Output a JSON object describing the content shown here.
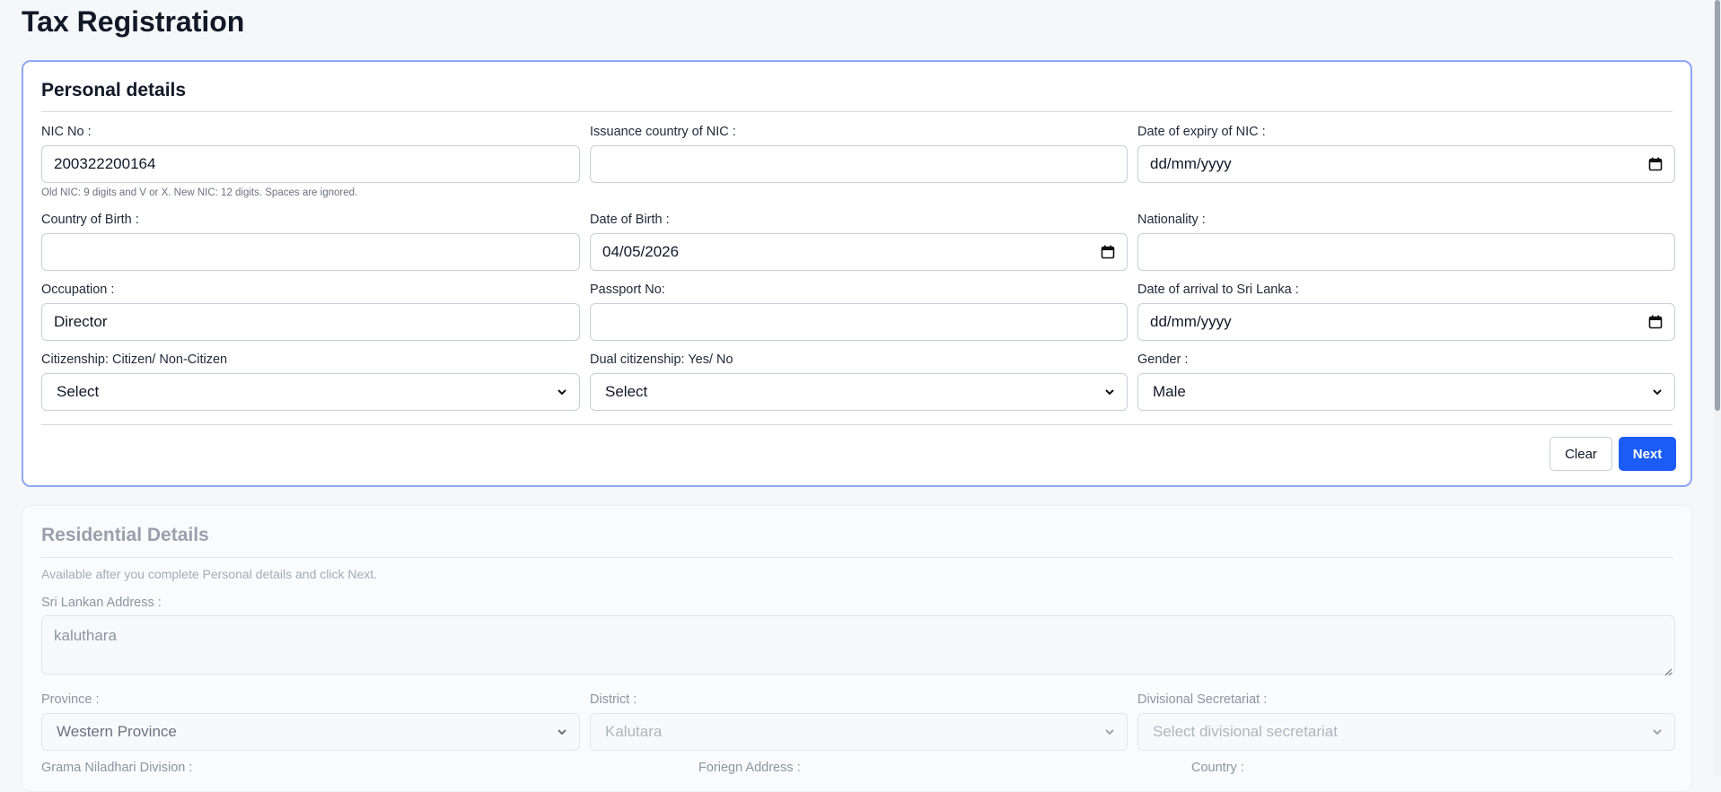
{
  "page": {
    "title": "Tax Registration"
  },
  "personal": {
    "title": "Personal details",
    "nic_label": "NIC No :",
    "nic_value": "200322200164",
    "nic_hint": "Old NIC: 9 digits and V or X. New NIC: 12 digits. Spaces are ignored.",
    "issuance_label": "Issuance country of NIC :",
    "issuance_value": "",
    "expiry_label": "Date of expiry of NIC :",
    "expiry_value": "dd/mm/yyyy",
    "birth_country_label": "Country of Birth :",
    "birth_country_value": "",
    "dob_label": "Date of Birth :",
    "dob_value": "04/05/2026",
    "nationality_label": "Nationality :",
    "nationality_value": "",
    "occupation_label": "Occupation :",
    "occupation_value": "Director",
    "passport_label": "Passport No:",
    "passport_value": "",
    "arrival_label": "Date of arrival to Sri Lanka :",
    "arrival_value": "dd/mm/yyyy",
    "citizenship_label": "Citizenship: Citizen/ Non-Citizen",
    "citizenship_value": "Select",
    "dual_label": "Dual citizenship: Yes/ No",
    "dual_value": "Select",
    "gender_label": "Gender :",
    "gender_value": "Male",
    "clear_label": "Clear",
    "next_label": "Next"
  },
  "residential": {
    "title": "Residential Details",
    "hint": "Available after you complete Personal details and click Next.",
    "address_label": "Sri Lankan Address :",
    "address_value": "kaluthara",
    "province_label": "Province :",
    "province_value": "Western Province",
    "district_label": "District :",
    "district_value": "Kalutara",
    "ds_label": "Divisional Secretariat :",
    "ds_value": "Select divisional secretariat",
    "gn_label": "Grama Niladhari Division :",
    "foreign_label": "Foriegn Address :",
    "country_label": "Country :"
  },
  "colors": {
    "accent": "#1a5cf5",
    "active_border": "#8ea6f3"
  }
}
